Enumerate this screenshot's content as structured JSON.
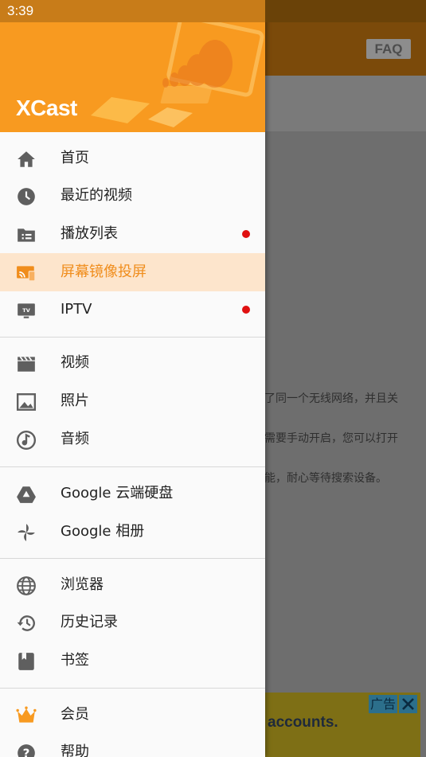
{
  "status_bar": {
    "time": "3:39"
  },
  "app": {
    "logo": "XCast",
    "faq_label": "FAQ"
  },
  "background": {
    "lines": [
      "接了同一个无线网络，并且关",
      "是需要手动开启，您可以打开",
      "功能，耐心等待搜索设备。"
    ],
    "ad": {
      "text": "accounts.",
      "tag": "广告"
    }
  },
  "menu": {
    "home": "首页",
    "recent_videos": "最近的视频",
    "playlists": "播放列表",
    "screen_mirroring": "屏幕镜像投屏",
    "iptv": "IPTV",
    "video": "视频",
    "photos": "照片",
    "audio": "音频",
    "google_drive": "Google 云端硬盘",
    "google_photos": "Google 相册",
    "browser": "浏览器",
    "history": "历史记录",
    "bookmarks": "书签",
    "vip": "会员",
    "help": "帮助"
  },
  "colors": {
    "accent": "#f89a20",
    "active_bg": "#fde5cc",
    "badge": "#e01010"
  }
}
